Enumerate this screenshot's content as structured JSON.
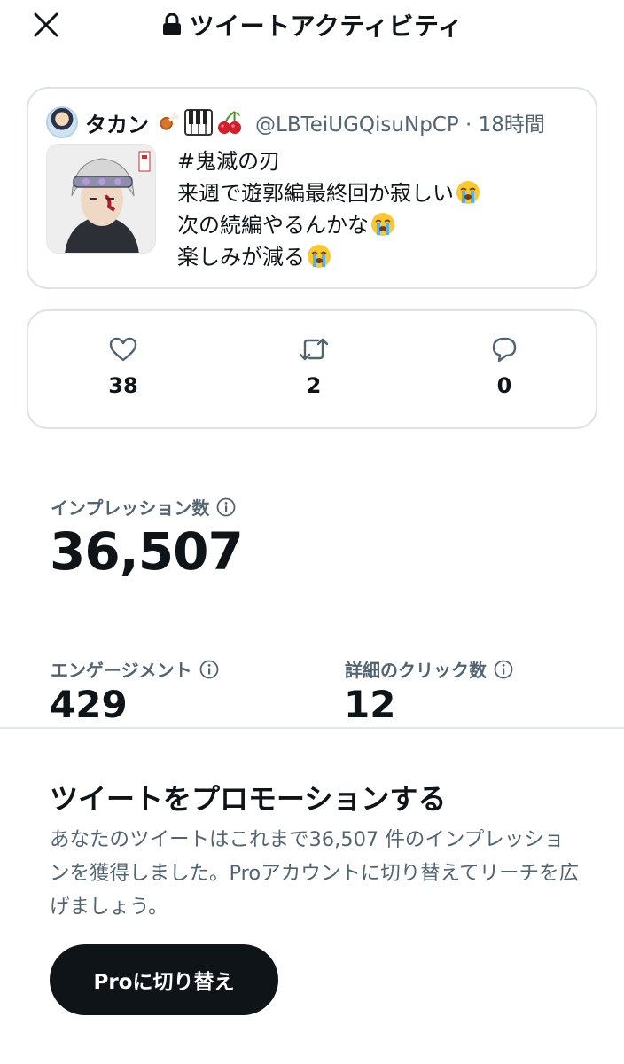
{
  "header": {
    "title": "ツイートアクティビティ",
    "close_icon": "close-icon",
    "lock_icon": "lock-icon"
  },
  "tweet": {
    "author_name": "タカン",
    "name_emojis": [
      "meat-on-bone-emoji",
      "piano-keys-emoji",
      "cherries-emoji"
    ],
    "handle_time": "@LBTeiUGQisuNpCP · 18時間",
    "lines": [
      {
        "text": "#鬼滅の刃",
        "emoji": null
      },
      {
        "text": "来週で遊郭編最終回か寂しい",
        "emoji": "loudly-crying-face"
      },
      {
        "text": "次の続編やるんかな",
        "emoji": "loudly-crying-face"
      },
      {
        "text": "楽しみが減る",
        "emoji": "loudly-crying-face"
      }
    ]
  },
  "engagements": {
    "likes": "38",
    "retweets": "2",
    "replies": "0"
  },
  "stats": {
    "impressions_label": "インプレッション数",
    "impressions_value": "36,507",
    "engagement_label": "エンゲージメント",
    "engagement_value": "429",
    "detail_clicks_label": "詳細のクリック数",
    "detail_clicks_value": "12"
  },
  "promo": {
    "title": "ツイートをプロモーションする",
    "description": "あなたのツイートはこれまで36,507 件のインプレッションを獲得しました。Proアカウントに切り替えてリーチを広げましょう。",
    "button_label": "Proに切り替え"
  },
  "colors": {
    "text_primary": "#0f1419",
    "text_secondary": "#536471",
    "border": "#dfe3e7",
    "button_bg": "#0f1419"
  }
}
